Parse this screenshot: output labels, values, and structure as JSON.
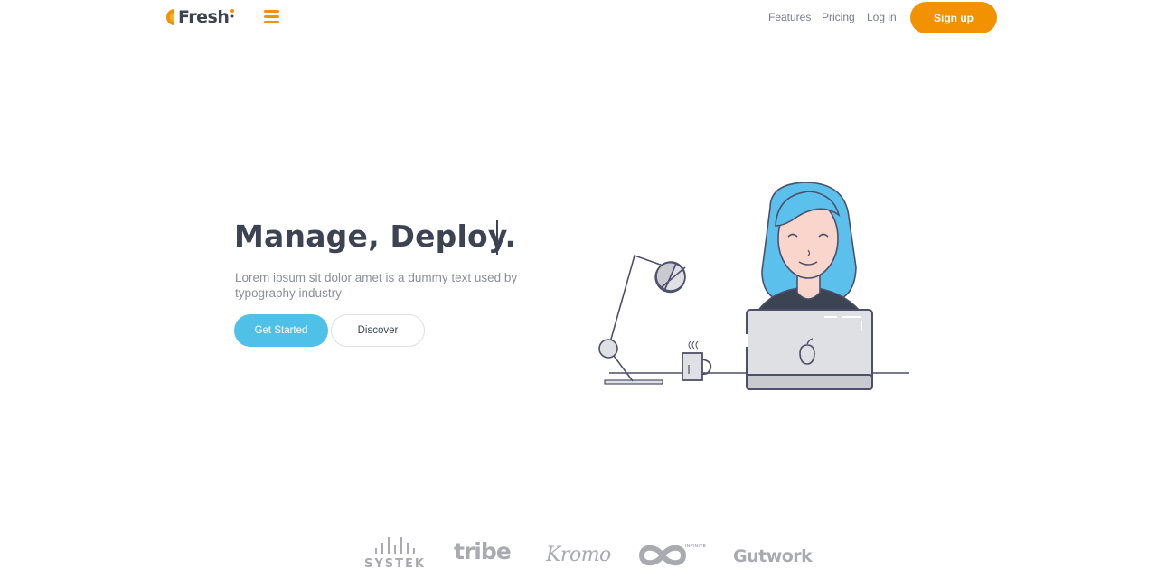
{
  "brand": {
    "name": "Fresh",
    "accent_color": "#f39200"
  },
  "nav": {
    "menu_icon": "hamburger-icon",
    "links": [
      "Features",
      "Pricing",
      "Log in"
    ],
    "signup_label": "Sign up"
  },
  "hero": {
    "title": "Manage, Deploy.",
    "subtitle": "Lorem ipsum sit dolor amet is a dummy text used by typography industry",
    "primary_cta": "Get Started",
    "secondary_cta": "Discover",
    "primary_color": "#4fc1e9",
    "illustration": "woman-at-laptop-illustration"
  },
  "clients": {
    "logos": [
      "SYSTEK",
      "tribe",
      "Kromo",
      "INFINITE",
      "Gutwork"
    ]
  }
}
